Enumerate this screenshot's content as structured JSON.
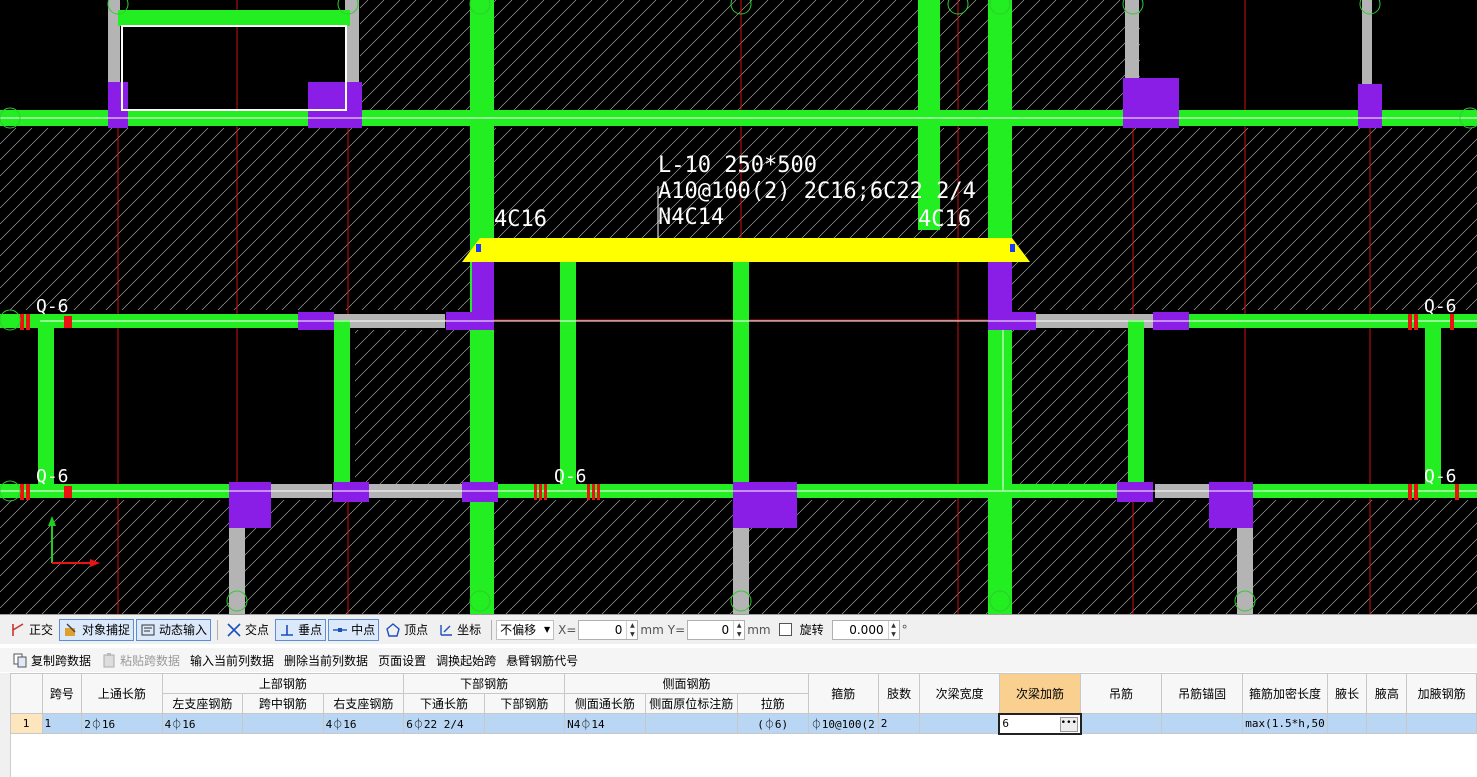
{
  "drawing": {
    "beam_label_line1": "L-10 250*500",
    "beam_label_line2": "A10@100(2) 2C16;6C22 2/4",
    "beam_label_line3": "N4C14",
    "left_support_label": "4C16",
    "right_support_label": "4C16",
    "tag_q6": "Q-6",
    "colors": {
      "beam_green": "#22ee22",
      "column_purple": "#8a1ee6",
      "selected_yellow": "#ffff00",
      "axis_red": "#cc1111",
      "wall_gray": "#b4b4b4"
    }
  },
  "snap_toolbar": {
    "ortho": "正交",
    "object_snap": "对象捕捉",
    "dynamic_input": "动态输入",
    "intersection": "交点",
    "perpendicular": "垂点",
    "midpoint": "中点",
    "vertex": "顶点",
    "coordinate": "坐标",
    "offset_mode": "不偏移",
    "x_label": "X=",
    "x_value": "0",
    "y_label": "Y=",
    "y_value": "0",
    "unit": "mm",
    "rotate_label": "旋转",
    "rotate_value": "0.000",
    "degree": "°"
  },
  "grid_toolbar": {
    "copy_span": "复制跨数据",
    "paste_span": "粘贴跨数据",
    "input_column": "输入当前列数据",
    "delete_column": "删除当前列数据",
    "page_setup": "页面设置",
    "swap_start_span": "调换起始跨",
    "cantilever_code": "悬臂钢筋代号"
  },
  "table": {
    "headers": {
      "span_no": "跨号",
      "top_through": "上通长筋",
      "top_rebar": "上部钢筋",
      "left_support": "左支座钢筋",
      "mid_span": "跨中钢筋",
      "right_support": "右支座钢筋",
      "bottom_rebar": "下部钢筋",
      "bottom_through": "下通长筋",
      "bottom_sub": "下部钢筋",
      "side_rebar": "侧面钢筋",
      "side_through": "侧面通长筋",
      "side_original": "侧面原位标注筋",
      "tie_bar": "拉筋",
      "stirrup": "箍筋",
      "legs": "肢数",
      "sec_beam_width": "次梁宽度",
      "sec_beam_add": "次梁加筋",
      "hanger": "吊筋",
      "hanger_anchor": "吊筋锚固",
      "stirrup_dense_len": "箍筋加密长度",
      "haunch_len": "腋长",
      "haunch_height": "腋高",
      "haunch_rebar": "加腋钢筋"
    },
    "row": {
      "row_index": "1",
      "span_no": "1",
      "top_through": "2⏀16",
      "left_support": "4⏀16",
      "mid_span": "",
      "right_support": "4⏀16",
      "bottom_through": "6⏀22 2/4",
      "bottom_sub": "",
      "side_through": "N4⏀14",
      "side_original": "",
      "tie_bar": "(⏀6)",
      "stirrup": "⏀10@100(2",
      "legs": "2",
      "sec_beam_width": "",
      "sec_beam_add": "6",
      "hanger": "",
      "hanger_anchor": "",
      "stirrup_dense_len": "max(1.5*h,50",
      "haunch_len": "",
      "haunch_height": "",
      "haunch_rebar": ""
    }
  }
}
